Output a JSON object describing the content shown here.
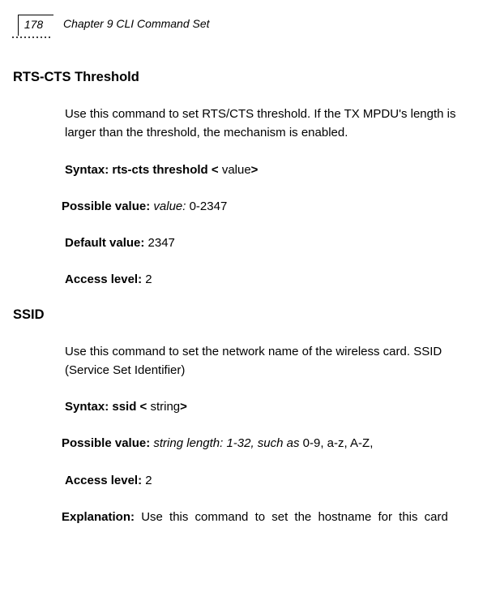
{
  "header": {
    "pageNumber": "178",
    "chapterTitle": "Chapter 9 CLI Command Set"
  },
  "section1": {
    "heading": "RTS-CTS Threshold",
    "desc": "Use this command to set RTS/CTS threshold. If the TX MPDU's length is larger than the threshold, the mechanism is enabled.",
    "syntaxLabel": "Syntax: rts-cts threshold < ",
    "syntaxValue": "value",
    "syntaxClose": ">",
    "pvLabel": "Possible value: ",
    "pvItalic": "value: ",
    "pvRange": " 0-2347",
    "defLabel": "Default value: ",
    "defValue": "2347",
    "accessLabel": "Access level: ",
    "accessValue": "2"
  },
  "section2": {
    "heading": "SSID",
    "desc": "Use this command to set the network name of the wireless card. SSID (Service Set Identifier)",
    "syntaxLabel": "Syntax: ssid < ",
    "syntaxValue": "string",
    "syntaxClose": ">",
    "pvLabel": "Possible value: ",
    "pvItalic": "string length: 1-32, such as ",
    "pvValue": "0-9, a-z, A-Z,",
    "accessLabel": "Access level: ",
    "accessValue": "2",
    "explLabel": "Explanation: ",
    "explText": "Use this command to set the hostname for this card"
  }
}
